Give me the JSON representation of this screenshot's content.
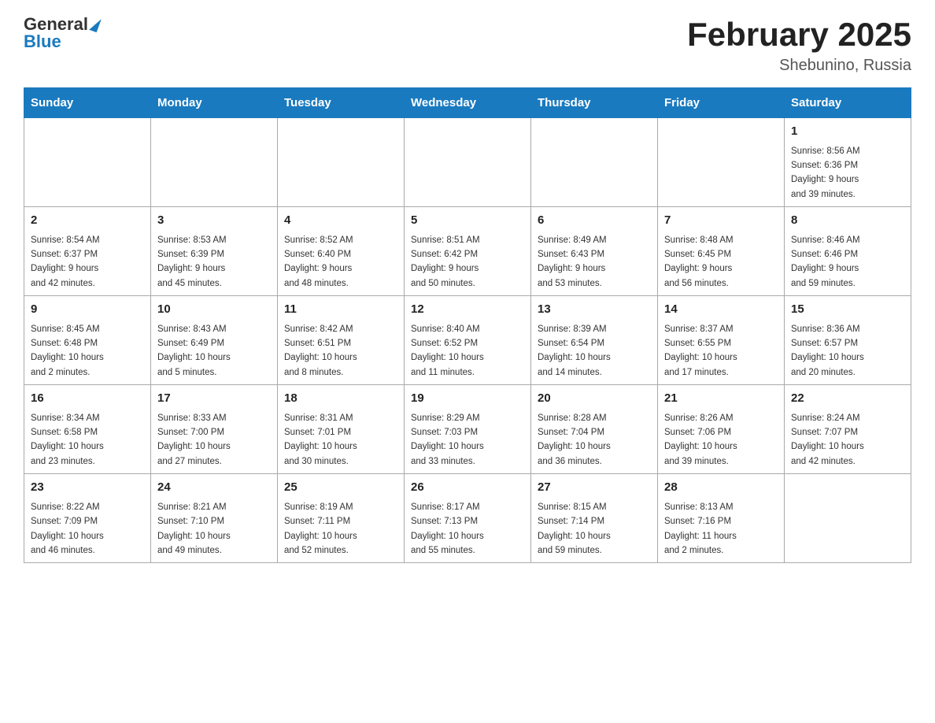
{
  "header": {
    "logo_general": "General",
    "logo_blue": "Blue",
    "month": "February 2025",
    "location": "Shebunino, Russia"
  },
  "weekdays": [
    "Sunday",
    "Monday",
    "Tuesday",
    "Wednesday",
    "Thursday",
    "Friday",
    "Saturday"
  ],
  "weeks": [
    [
      {
        "day": "",
        "info": ""
      },
      {
        "day": "",
        "info": ""
      },
      {
        "day": "",
        "info": ""
      },
      {
        "day": "",
        "info": ""
      },
      {
        "day": "",
        "info": ""
      },
      {
        "day": "",
        "info": ""
      },
      {
        "day": "1",
        "info": "Sunrise: 8:56 AM\nSunset: 6:36 PM\nDaylight: 9 hours\nand 39 minutes."
      }
    ],
    [
      {
        "day": "2",
        "info": "Sunrise: 8:54 AM\nSunset: 6:37 PM\nDaylight: 9 hours\nand 42 minutes."
      },
      {
        "day": "3",
        "info": "Sunrise: 8:53 AM\nSunset: 6:39 PM\nDaylight: 9 hours\nand 45 minutes."
      },
      {
        "day": "4",
        "info": "Sunrise: 8:52 AM\nSunset: 6:40 PM\nDaylight: 9 hours\nand 48 minutes."
      },
      {
        "day": "5",
        "info": "Sunrise: 8:51 AM\nSunset: 6:42 PM\nDaylight: 9 hours\nand 50 minutes."
      },
      {
        "day": "6",
        "info": "Sunrise: 8:49 AM\nSunset: 6:43 PM\nDaylight: 9 hours\nand 53 minutes."
      },
      {
        "day": "7",
        "info": "Sunrise: 8:48 AM\nSunset: 6:45 PM\nDaylight: 9 hours\nand 56 minutes."
      },
      {
        "day": "8",
        "info": "Sunrise: 8:46 AM\nSunset: 6:46 PM\nDaylight: 9 hours\nand 59 minutes."
      }
    ],
    [
      {
        "day": "9",
        "info": "Sunrise: 8:45 AM\nSunset: 6:48 PM\nDaylight: 10 hours\nand 2 minutes."
      },
      {
        "day": "10",
        "info": "Sunrise: 8:43 AM\nSunset: 6:49 PM\nDaylight: 10 hours\nand 5 minutes."
      },
      {
        "day": "11",
        "info": "Sunrise: 8:42 AM\nSunset: 6:51 PM\nDaylight: 10 hours\nand 8 minutes."
      },
      {
        "day": "12",
        "info": "Sunrise: 8:40 AM\nSunset: 6:52 PM\nDaylight: 10 hours\nand 11 minutes."
      },
      {
        "day": "13",
        "info": "Sunrise: 8:39 AM\nSunset: 6:54 PM\nDaylight: 10 hours\nand 14 minutes."
      },
      {
        "day": "14",
        "info": "Sunrise: 8:37 AM\nSunset: 6:55 PM\nDaylight: 10 hours\nand 17 minutes."
      },
      {
        "day": "15",
        "info": "Sunrise: 8:36 AM\nSunset: 6:57 PM\nDaylight: 10 hours\nand 20 minutes."
      }
    ],
    [
      {
        "day": "16",
        "info": "Sunrise: 8:34 AM\nSunset: 6:58 PM\nDaylight: 10 hours\nand 23 minutes."
      },
      {
        "day": "17",
        "info": "Sunrise: 8:33 AM\nSunset: 7:00 PM\nDaylight: 10 hours\nand 27 minutes."
      },
      {
        "day": "18",
        "info": "Sunrise: 8:31 AM\nSunset: 7:01 PM\nDaylight: 10 hours\nand 30 minutes."
      },
      {
        "day": "19",
        "info": "Sunrise: 8:29 AM\nSunset: 7:03 PM\nDaylight: 10 hours\nand 33 minutes."
      },
      {
        "day": "20",
        "info": "Sunrise: 8:28 AM\nSunset: 7:04 PM\nDaylight: 10 hours\nand 36 minutes."
      },
      {
        "day": "21",
        "info": "Sunrise: 8:26 AM\nSunset: 7:06 PM\nDaylight: 10 hours\nand 39 minutes."
      },
      {
        "day": "22",
        "info": "Sunrise: 8:24 AM\nSunset: 7:07 PM\nDaylight: 10 hours\nand 42 minutes."
      }
    ],
    [
      {
        "day": "23",
        "info": "Sunrise: 8:22 AM\nSunset: 7:09 PM\nDaylight: 10 hours\nand 46 minutes."
      },
      {
        "day": "24",
        "info": "Sunrise: 8:21 AM\nSunset: 7:10 PM\nDaylight: 10 hours\nand 49 minutes."
      },
      {
        "day": "25",
        "info": "Sunrise: 8:19 AM\nSunset: 7:11 PM\nDaylight: 10 hours\nand 52 minutes."
      },
      {
        "day": "26",
        "info": "Sunrise: 8:17 AM\nSunset: 7:13 PM\nDaylight: 10 hours\nand 55 minutes."
      },
      {
        "day": "27",
        "info": "Sunrise: 8:15 AM\nSunset: 7:14 PM\nDaylight: 10 hours\nand 59 minutes."
      },
      {
        "day": "28",
        "info": "Sunrise: 8:13 AM\nSunset: 7:16 PM\nDaylight: 11 hours\nand 2 minutes."
      },
      {
        "day": "",
        "info": ""
      }
    ]
  ]
}
